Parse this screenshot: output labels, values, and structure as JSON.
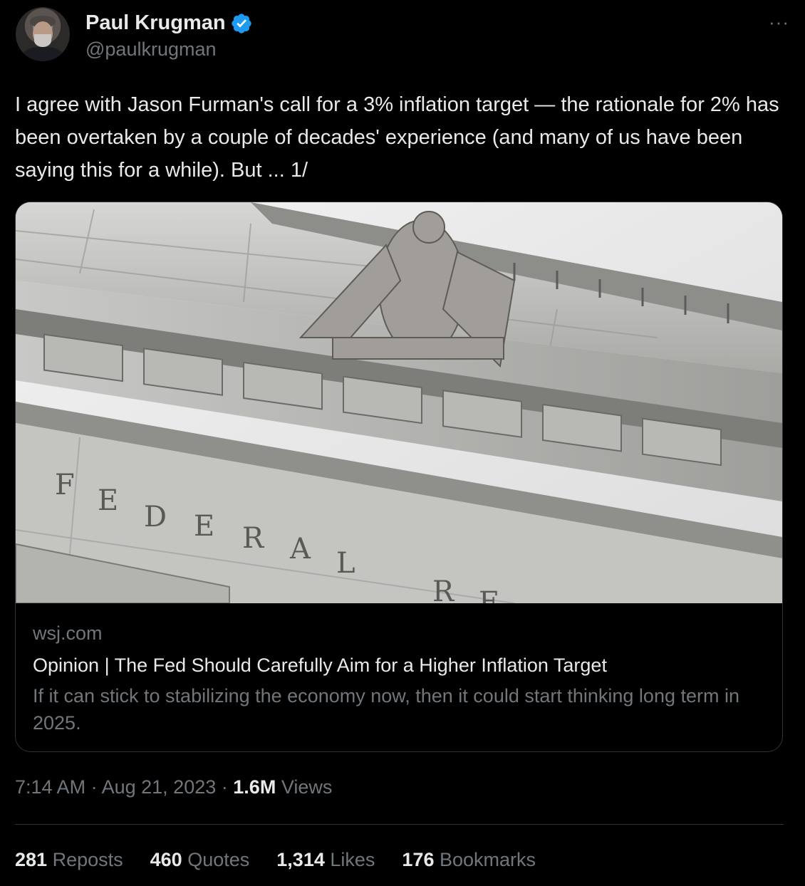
{
  "author": {
    "name": "Paul Krugman",
    "handle": "@paulkrugman",
    "verified_color": "#1d9bf0"
  },
  "icons": {
    "verified": "verified-badge-icon",
    "more": "more-options-icon",
    "more_glyph": "···"
  },
  "tweet": {
    "text": "I agree with Jason Furman's call for a 3% inflation target — the rationale for 2% has been overtaken by a couple of decades' experience (and many of us have been saying this for a while). But ... 1/"
  },
  "card": {
    "domain": "wsj.com",
    "title": "Opinion | The Fed Should Carefully Aim for a Higher Inflation Target",
    "description": "If it can stick to stabilizing the economy now, then it could start thinking long term in 2025.",
    "image_letters": [
      "F",
      "E",
      "D",
      "E",
      "R",
      "A",
      "L",
      "R",
      "E"
    ]
  },
  "meta": {
    "time": "7:14 AM",
    "separator": "·",
    "date": "Aug 21, 2023",
    "views_count": "1.6M",
    "views_label": "Views"
  },
  "stats": [
    {
      "count": "281",
      "label": "Reposts"
    },
    {
      "count": "460",
      "label": "Quotes"
    },
    {
      "count": "1,314",
      "label": "Likes"
    },
    {
      "count": "176",
      "label": "Bookmarks"
    }
  ],
  "colors": {
    "background": "#000000",
    "text": "#e7e9ea",
    "muted": "#71767b",
    "border": "#2f3336"
  }
}
